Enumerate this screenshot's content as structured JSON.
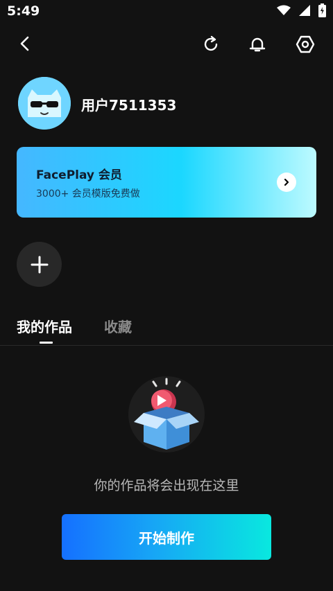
{
  "status_bar": {
    "time": "5:49",
    "icons": [
      "wifi-icon",
      "signal-icon",
      "battery-charging-icon"
    ]
  },
  "top_bar": {
    "icons": [
      "back-icon",
      "refresh-icon",
      "bell-icon",
      "settings-icon"
    ]
  },
  "profile": {
    "username": "用户7511353"
  },
  "member_card": {
    "title": "FacePlay 会员",
    "subtitle": "3000+ 会员模版免费做"
  },
  "tabs": [
    {
      "label": "我的作品",
      "active": true
    },
    {
      "label": "收藏",
      "active": false
    }
  ],
  "empty_state": {
    "message": "你的作品将会出现在这里"
  },
  "start_button": {
    "label": "开始制作"
  },
  "colors": {
    "background": "#121212",
    "member_gradient_start": "#45b7ff",
    "member_gradient_end": "#bdfaff",
    "button_gradient_start": "#1570ff",
    "button_gradient_end": "#09e8df"
  }
}
